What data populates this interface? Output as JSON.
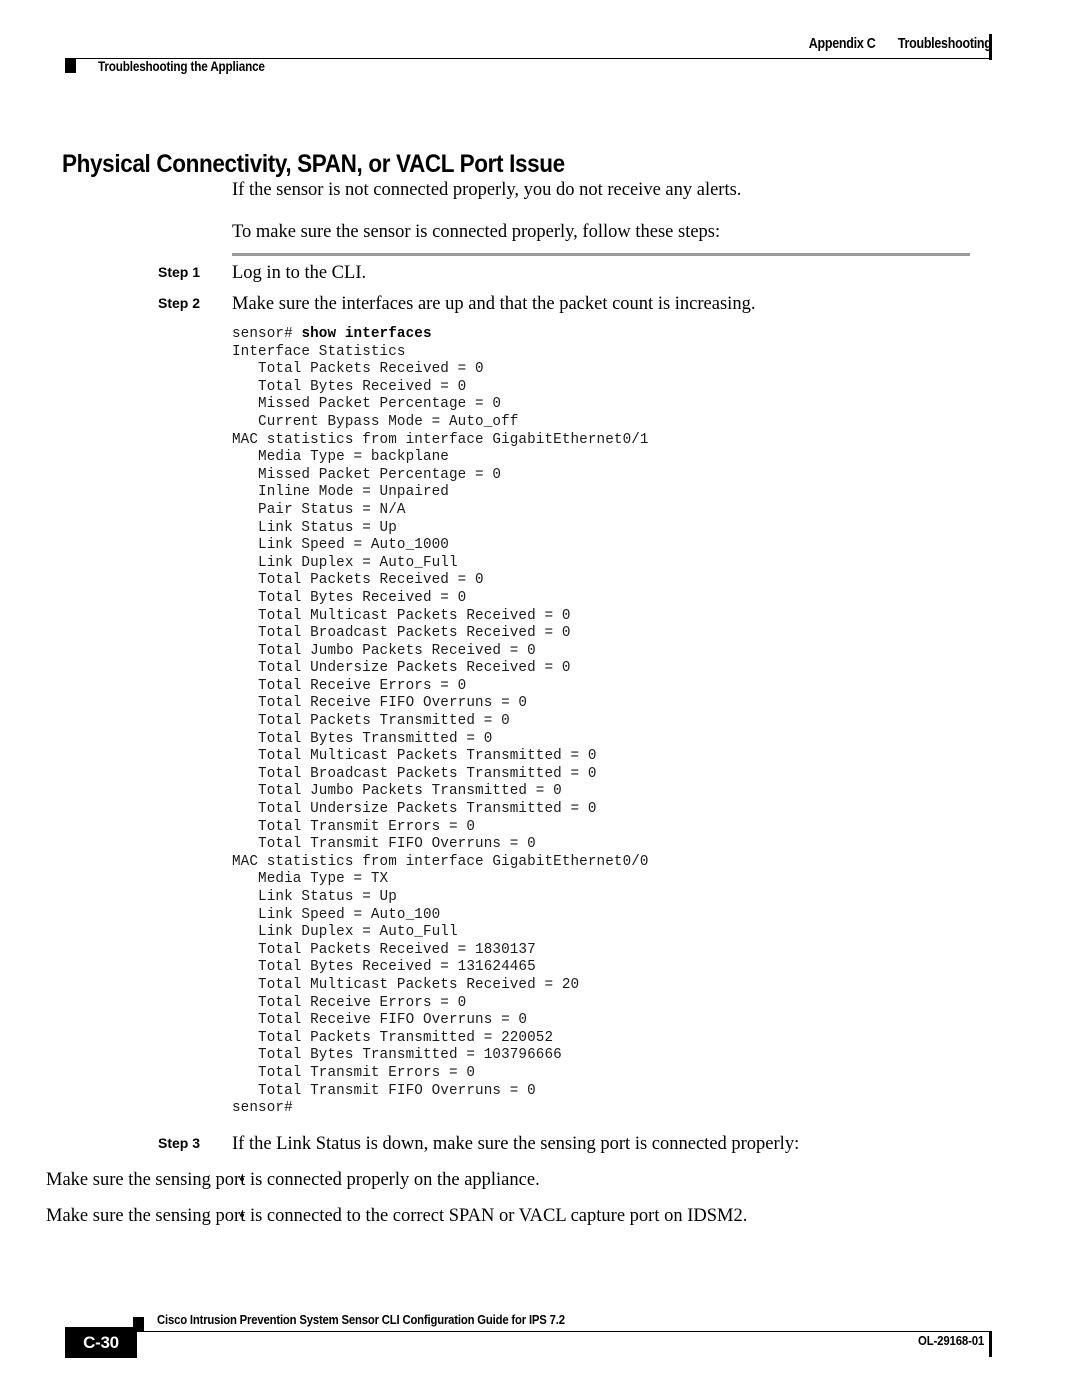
{
  "header": {
    "appendix": "Appendix C",
    "chapter": "Troubleshooting",
    "running_head": "Troubleshooting the Appliance"
  },
  "title": "Physical Connectivity, SPAN, or VACL Port Issue",
  "intro": {
    "para1": "If the sensor is not connected properly, you do not receive any alerts.",
    "para2": "To make sure the sensor is connected properly, follow these steps:"
  },
  "steps": [
    {
      "label": "Step 1",
      "text": "Log in to the CLI."
    },
    {
      "label": "Step 2",
      "text": "Make sure the interfaces are up and that the packet count is increasing."
    },
    {
      "label": "Step 3",
      "text": "If the Link Status is down, make sure the sensing port is connected properly:"
    }
  ],
  "code_block": {
    "prompt": "sensor# ",
    "command": "show interfaces",
    "output": "Interface Statistics\n   Total Packets Received = 0\n   Total Bytes Received = 0\n   Missed Packet Percentage = 0\n   Current Bypass Mode = Auto_off\nMAC statistics from interface GigabitEthernet0/1\n   Media Type = backplane\n   Missed Packet Percentage = 0\n   Inline Mode = Unpaired\n   Pair Status = N/A\n   Link Status = Up\n   Link Speed = Auto_1000\n   Link Duplex = Auto_Full\n   Total Packets Received = 0\n   Total Bytes Received = 0\n   Total Multicast Packets Received = 0\n   Total Broadcast Packets Received = 0\n   Total Jumbo Packets Received = 0\n   Total Undersize Packets Received = 0\n   Total Receive Errors = 0\n   Total Receive FIFO Overruns = 0\n   Total Packets Transmitted = 0\n   Total Bytes Transmitted = 0\n   Total Multicast Packets Transmitted = 0\n   Total Broadcast Packets Transmitted = 0\n   Total Jumbo Packets Transmitted = 0\n   Total Undersize Packets Transmitted = 0\n   Total Transmit Errors = 0\n   Total Transmit FIFO Overruns = 0\nMAC statistics from interface GigabitEthernet0/0\n   Media Type = TX\n   Link Status = Up\n   Link Speed = Auto_100\n   Link Duplex = Auto_Full\n   Total Packets Received = 1830137\n   Total Bytes Received = 131624465\n   Total Multicast Packets Received = 20\n   Total Receive Errors = 0\n   Total Receive FIFO Overruns = 0\n   Total Packets Transmitted = 220052\n   Total Bytes Transmitted = 103796666\n   Total Transmit Errors = 0\n   Total Transmit FIFO Overruns = 0\nsensor#"
  },
  "bullets": [
    {
      "marker": "•",
      "text": "Make sure the sensing port is connected properly on the appliance."
    },
    {
      "marker": "•",
      "text": "Make sure the sensing port is connected to the correct SPAN or VACL capture port on IDSM2."
    }
  ],
  "footer": {
    "guide_title": "Cisco Intrusion Prevention System Sensor CLI Configuration Guide for IPS 7.2",
    "page_number": "C-30",
    "doc_id": "OL-29168-01"
  }
}
